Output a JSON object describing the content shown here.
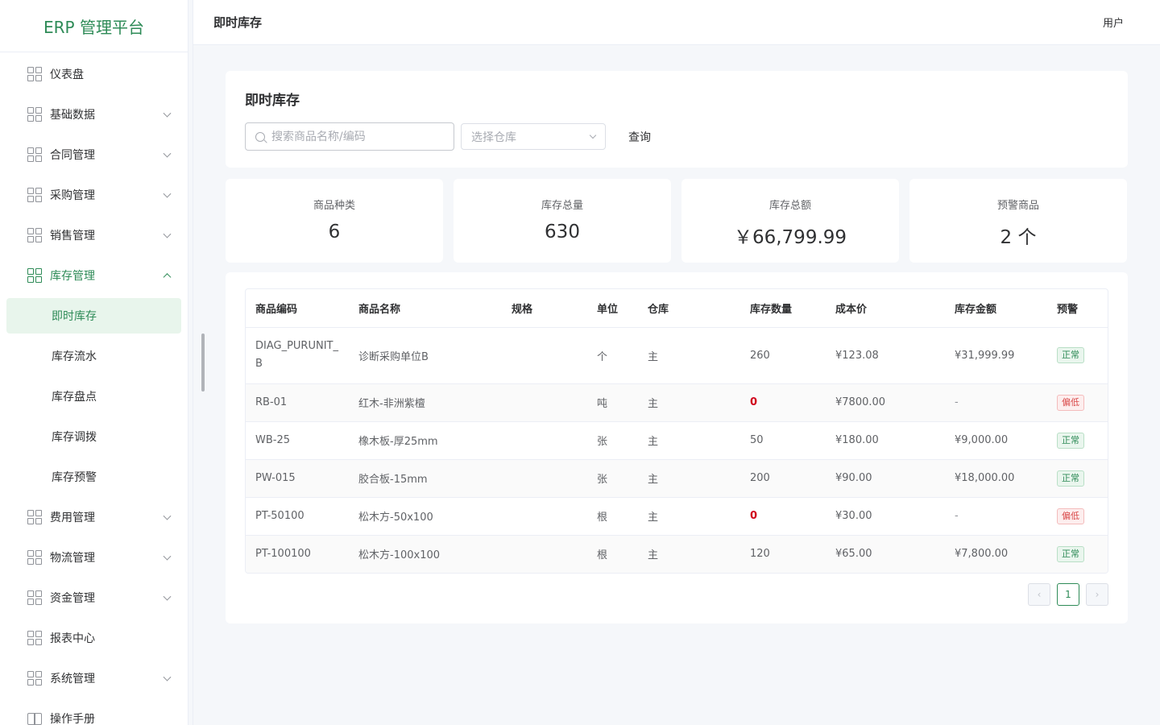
{
  "app": {
    "title": "ERP 管理平台"
  },
  "sidebar": {
    "items": [
      {
        "label": "仪表盘"
      },
      {
        "label": "基础数据"
      },
      {
        "label": "合同管理"
      },
      {
        "label": "采购管理"
      },
      {
        "label": "销售管理"
      },
      {
        "label": "库存管理"
      },
      {
        "label": "费用管理"
      },
      {
        "label": "物流管理"
      },
      {
        "label": "资金管理"
      },
      {
        "label": "报表中心"
      },
      {
        "label": "系统管理"
      },
      {
        "label": "操作手册"
      }
    ],
    "inventory_sub": [
      {
        "label": "即时库存"
      },
      {
        "label": "库存流水"
      },
      {
        "label": "库存盘点"
      },
      {
        "label": "库存调拨"
      },
      {
        "label": "库存预警"
      }
    ]
  },
  "header": {
    "title": "即时库存",
    "user": "用户"
  },
  "filter": {
    "title": "即时库存",
    "search_placeholder": "搜索商品名称/编码",
    "warehouse_placeholder": "选择仓库",
    "query_label": "查询"
  },
  "stats": [
    {
      "label": "商品种类",
      "value": "6"
    },
    {
      "label": "库存总量",
      "value": "630"
    },
    {
      "label": "库存总额",
      "value": "￥66,799.99"
    },
    {
      "label": "预警商品",
      "value": "2 个"
    }
  ],
  "table": {
    "headers": [
      "商品编码",
      "商品名称",
      "规格",
      "单位",
      "仓库",
      "库存数量",
      "成本价",
      "库存金额",
      "预警"
    ],
    "rows": [
      {
        "code": "DIAG_PURUNIT_B",
        "name": "诊断采购单位B",
        "spec": "",
        "unit": "个",
        "warehouse": "主",
        "qty": "260",
        "cost": "¥123.08",
        "amount": "¥31,999.99",
        "alert": "正常"
      },
      {
        "code": "RB-01",
        "name": "红木-非洲紫檀",
        "spec": "",
        "unit": "吨",
        "warehouse": "主",
        "qty": "0",
        "cost": "¥7800.00",
        "amount": "-",
        "alert": "偏低"
      },
      {
        "code": "WB-25",
        "name": "橡木板-厚25mm",
        "spec": "",
        "unit": "张",
        "warehouse": "主",
        "qty": "50",
        "cost": "¥180.00",
        "amount": "¥9,000.00",
        "alert": "正常"
      },
      {
        "code": "PW-015",
        "name": "胶合板-15mm",
        "spec": "",
        "unit": "张",
        "warehouse": "主",
        "qty": "200",
        "cost": "¥90.00",
        "amount": "¥18,000.00",
        "alert": "正常"
      },
      {
        "code": "PT-50100",
        "name": "松木方-50x100",
        "spec": "",
        "unit": "根",
        "warehouse": "主",
        "qty": "0",
        "cost": "¥30.00",
        "amount": "-",
        "alert": "偏低"
      },
      {
        "code": "PT-100100",
        "name": "松木方-100x100",
        "spec": "",
        "unit": "根",
        "warehouse": "主",
        "qty": "120",
        "cost": "¥65.00",
        "amount": "¥7,800.00",
        "alert": "正常"
      }
    ]
  },
  "pagination": {
    "current": "1"
  },
  "colors": {
    "brand": "#2e8b57",
    "danger": "#d0021b"
  }
}
